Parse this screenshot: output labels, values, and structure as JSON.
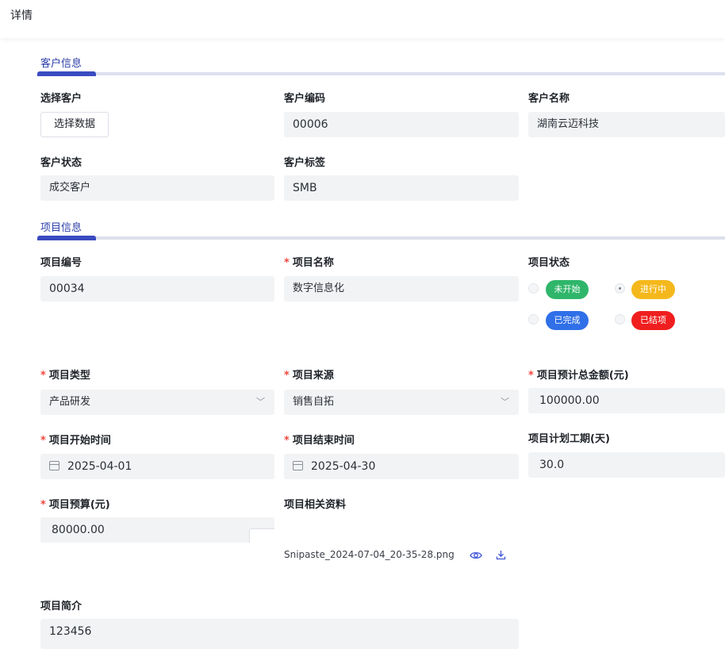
{
  "page": {
    "title": "详情"
  },
  "customer_section": {
    "title": "客户信息",
    "select_customer": {
      "label": "选择客户",
      "button": "选择数据"
    },
    "customer_code": {
      "label": "客户编码",
      "value": "00006"
    },
    "customer_name": {
      "label": "客户名称",
      "value": "湖南云迈科技"
    },
    "customer_status": {
      "label": "客户状态",
      "value": "成交客户"
    },
    "customer_tag": {
      "label": "客户标签",
      "value": "SMB"
    }
  },
  "project_section": {
    "title": "项目信息",
    "project_no": {
      "label": "项目编号",
      "value": "00034"
    },
    "project_name": {
      "label": "项目名称",
      "value": "数字信息化",
      "required": "*"
    },
    "project_status": {
      "label": "项目状态",
      "options": [
        {
          "label": "未开始",
          "color": "#2fb66a",
          "checked": false
        },
        {
          "label": "进行中",
          "color": "#f5b81c",
          "checked": true
        },
        {
          "label": "已完成",
          "color": "#2f6fe8",
          "checked": false
        },
        {
          "label": "已结项",
          "color": "#f01e1e",
          "checked": false
        }
      ]
    },
    "project_type": {
      "label": "项目类型",
      "value": "产品研发",
      "required": "*"
    },
    "project_source": {
      "label": "项目来源",
      "value": "销售自拓",
      "required": "*"
    },
    "project_total": {
      "label": "项目预计总金额(元)",
      "value": "100000.00",
      "required": "*"
    },
    "start_time": {
      "label": "项目开始时间",
      "value": "2025-04-01",
      "required": "*"
    },
    "end_time": {
      "label": "项目结束时间",
      "value": "2025-04-30",
      "required": "*"
    },
    "plan_days": {
      "label": "项目计划工期(天)",
      "value": "30.0"
    },
    "budget": {
      "label": "项目预算(元)",
      "value": "80000.00",
      "required": "*"
    },
    "attachments": {
      "label": "项目相关资料",
      "file": "Snipaste_2024-07-04_20-35-28.png"
    },
    "intro": {
      "label": "项目简介",
      "value": "123456"
    }
  },
  "colors": {
    "accent": "#3a4bc1",
    "required": "#f0483e",
    "field_bg": "#f2f3f5"
  }
}
